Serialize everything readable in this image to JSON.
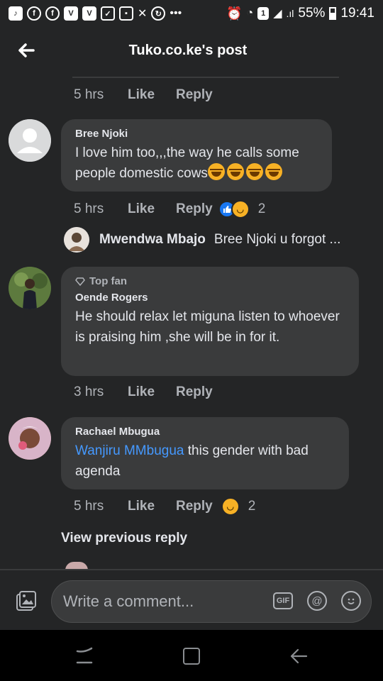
{
  "status_bar": {
    "battery": "55%",
    "time": "19:41"
  },
  "header": {
    "title": "Tuko.co.ke's post"
  },
  "first_meta": {
    "time": "5 hrs",
    "like": "Like",
    "reply": "Reply"
  },
  "comments": [
    {
      "author": "Bree Njoki",
      "text": "I love him too,,,the way he calls some people domestic cows",
      "emoji_count": 4,
      "time": "5 hrs",
      "like": "Like",
      "reply": "Reply",
      "reaction_count": "2",
      "reactions": [
        "like",
        "haha"
      ]
    },
    {
      "badge": "Top fan",
      "author": "Oende Rogers",
      "text": "He should relax let miguna listen to whoever is praising him ,she will be in for it.",
      "time": "3 hrs",
      "like": "Like",
      "reply": "Reply"
    },
    {
      "author": "Rachael Mbugua",
      "mention": "Wanjiru MMbugua",
      "text": " this gender with bad agenda",
      "time": "5 hrs",
      "like": "Like",
      "reply": "Reply",
      "reaction_count": "2",
      "reactions": [
        "haha"
      ]
    }
  ],
  "reply_preview": {
    "name": "Mwendwa Mbajo",
    "text": "Bree Njoki u forgot ..."
  },
  "view_previous": "View previous reply",
  "composer": {
    "placeholder": "Write a comment...",
    "gif_label": "GIF"
  },
  "colors": {
    "background": "#242526",
    "bubble": "#3a3b3c",
    "mention": "#4599ff",
    "like_blue": "#1877f2",
    "haha_yellow": "#f7b125"
  }
}
